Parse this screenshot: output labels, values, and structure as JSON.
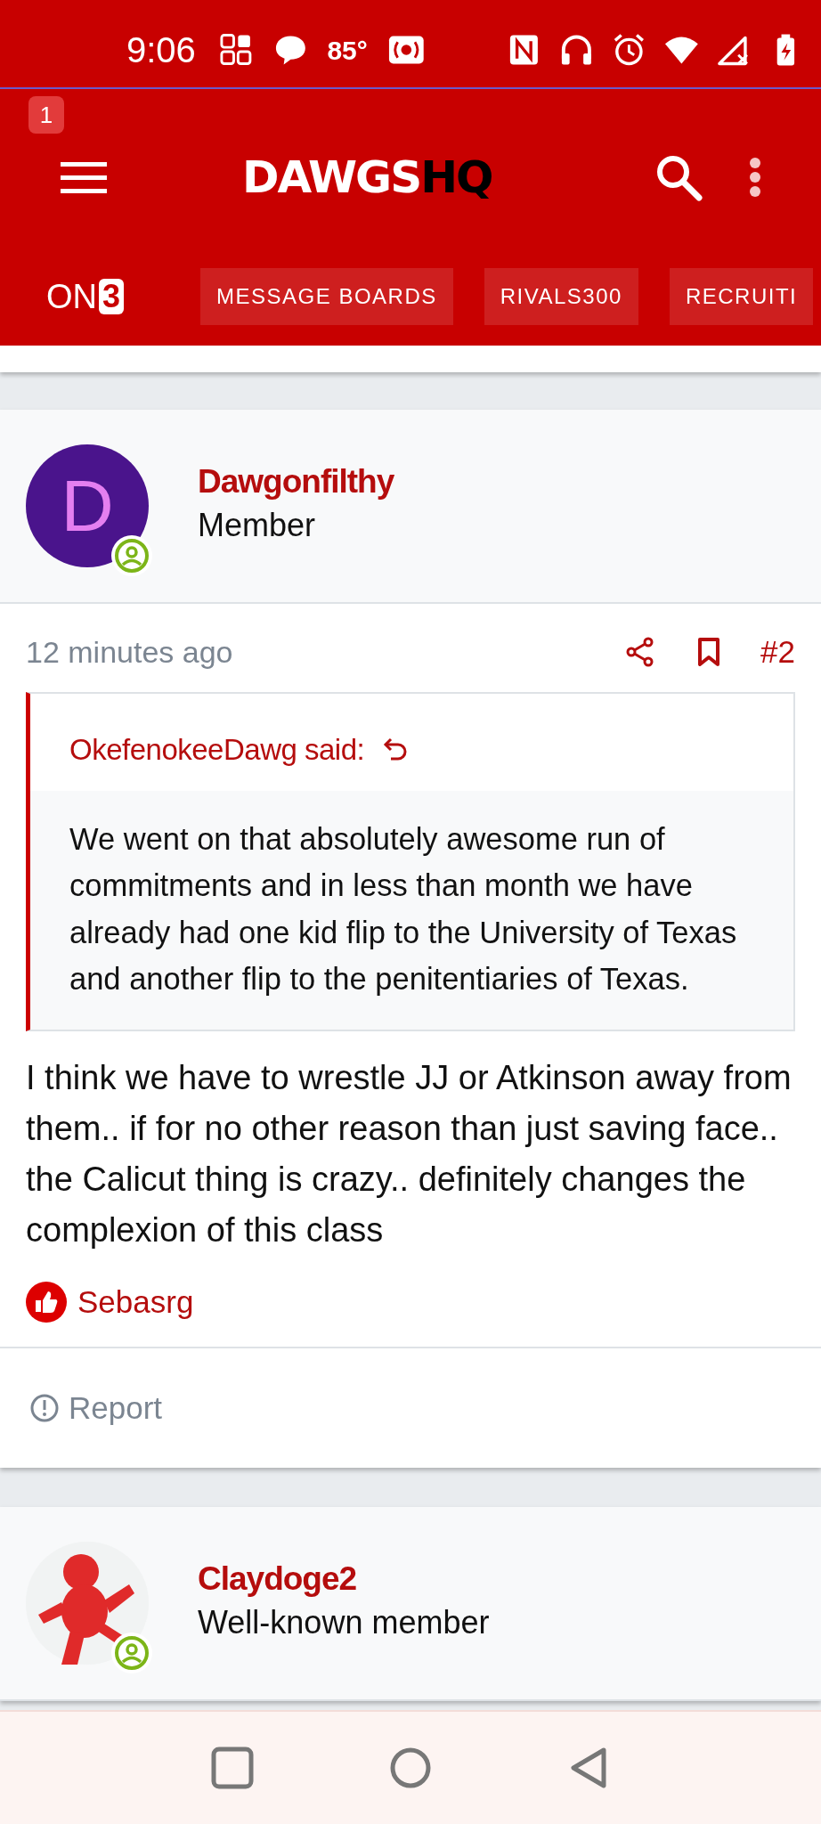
{
  "status_bar": {
    "time": "9:06",
    "temperature": "85°"
  },
  "header": {
    "notification_count": "1",
    "logo": {
      "primary": "DAWGS",
      "accent": "HQ"
    },
    "brand": {
      "text": "ON",
      "boxed": "3"
    },
    "nav_tabs": [
      {
        "label": "MESSAGE BOARDS"
      },
      {
        "label": "RIVALS300"
      },
      {
        "label": "RECRUITI"
      }
    ]
  },
  "posts": [
    {
      "author": "Dawgonfilthy",
      "role": "Member",
      "avatar": {
        "kind": "letter",
        "letter": "D",
        "color": "#4a148c"
      },
      "online": true,
      "time": "12 minutes ago",
      "number": "#2",
      "quote": {
        "author": "OkefenokeeDawg said:",
        "text": "We went on that absolutely awesome run of commitments and in less than month we have already had one kid flip to the University of Texas and another flip to the penitentiaries of Texas."
      },
      "body": "I think we have to wrestle JJ or Atkinson away from them.. if for no other reason than just saving face.. the Calicut thing is crazy.. definitely changes the complexion of this class",
      "likes": [
        "Sebasrg"
      ],
      "actions": [
        "Report"
      ]
    },
    {
      "author": "Claydoge2",
      "role": "Well-known member",
      "online": true
    }
  ]
}
